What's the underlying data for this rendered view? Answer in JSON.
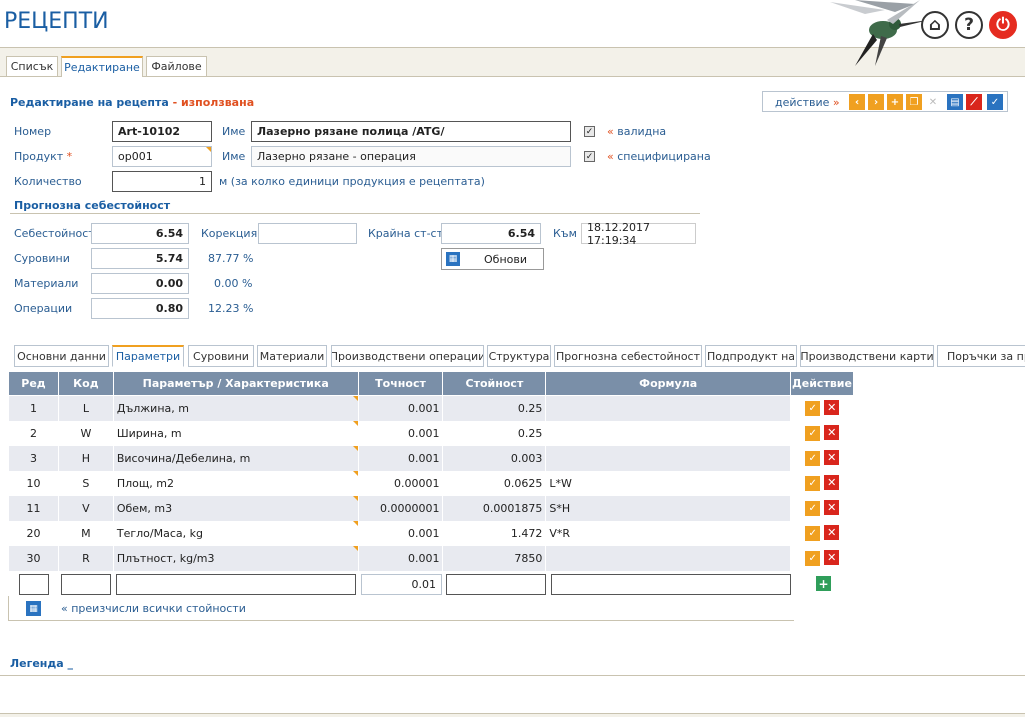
{
  "app": {
    "title": "РЕЦЕПТИ"
  },
  "main_tabs": [
    "Списък",
    "Редактиране",
    "Файлове"
  ],
  "edit": {
    "title": "Редактиране на рецепта",
    "dash": " - ",
    "status": "използвана"
  },
  "actions": {
    "label": "действие",
    "arrow": "»"
  },
  "form": {
    "number_label": "Номер",
    "number_value": "Art-10102",
    "name_label": "Име",
    "name_value": "Лазерно рязане полица /ATG/",
    "valid_label": "« валидна",
    "product_label": "Продукт",
    "product_required": "*",
    "product_value": "op001",
    "name2_label": "Име",
    "name2_value": "Лазерно рязане - операция",
    "specified_label": "« специфицирана",
    "qty_label": "Количество",
    "qty_value": "1",
    "qty_unit": "м (за колко единици продукция е рецептата)"
  },
  "cost": {
    "title": "Прогнозна себестойност",
    "cost_label": "Себестойност",
    "cost_value": "6.54",
    "correction_label": "Корекция",
    "correction_value": "",
    "final_label": "Крайна ст-ст",
    "final_value": "6.54",
    "to_label": "Към",
    "to_value": "18.12.2017 17:19:34",
    "raw_label": "Суровини",
    "raw_value": "5.74",
    "raw_pct": "87.77 %",
    "refresh_label": "Обнови",
    "mat_label": "Материали",
    "mat_value": "0.00",
    "mat_pct": "0.00 %",
    "ops_label": "Операции",
    "ops_value": "0.80",
    "ops_pct": "12.23 %"
  },
  "sub_tabs": [
    "Основни данни",
    "Параметри",
    "Суровини",
    "Материали",
    "Производствени операции",
    "Структура",
    "Прогнозна себестойност",
    "Подпродукт на",
    "Производствени карти",
    "Поръчки за про"
  ],
  "table": {
    "headers": [
      "Ред",
      "Код",
      "Параметър / Характеристика",
      "Точност",
      "Стойност",
      "Формула",
      "Действие"
    ],
    "rows": [
      {
        "row": "1",
        "code": "L",
        "param": "Дължина, m",
        "precision": "0.001",
        "value": "0.25",
        "formula": ""
      },
      {
        "row": "2",
        "code": "W",
        "param": "Ширина, m",
        "precision": "0.001",
        "value": "0.25",
        "formula": ""
      },
      {
        "row": "3",
        "code": "H",
        "param": "Височина/Дебелина, m",
        "precision": "0.001",
        "value": "0.003",
        "formula": ""
      },
      {
        "row": "10",
        "code": "S",
        "param": "Площ, m2",
        "precision": "0.00001",
        "value": "0.0625",
        "formula": "L*W"
      },
      {
        "row": "11",
        "code": "V",
        "param": "Обем, m3",
        "precision": "0.0000001",
        "value": "0.0001875",
        "formula": "S*H"
      },
      {
        "row": "20",
        "code": "M",
        "param": "Тегло/Маса, kg",
        "precision": "0.001",
        "value": "1.472",
        "formula": "V*R"
      },
      {
        "row": "30",
        "code": "R",
        "param": "Плътност, kg/m3",
        "precision": "0.001",
        "value": "7850",
        "formula": ""
      }
    ],
    "new_precision": "0.01",
    "recalc_label": "« преизчисли всички стойности"
  },
  "legend": {
    "label": "Легенда _"
  }
}
